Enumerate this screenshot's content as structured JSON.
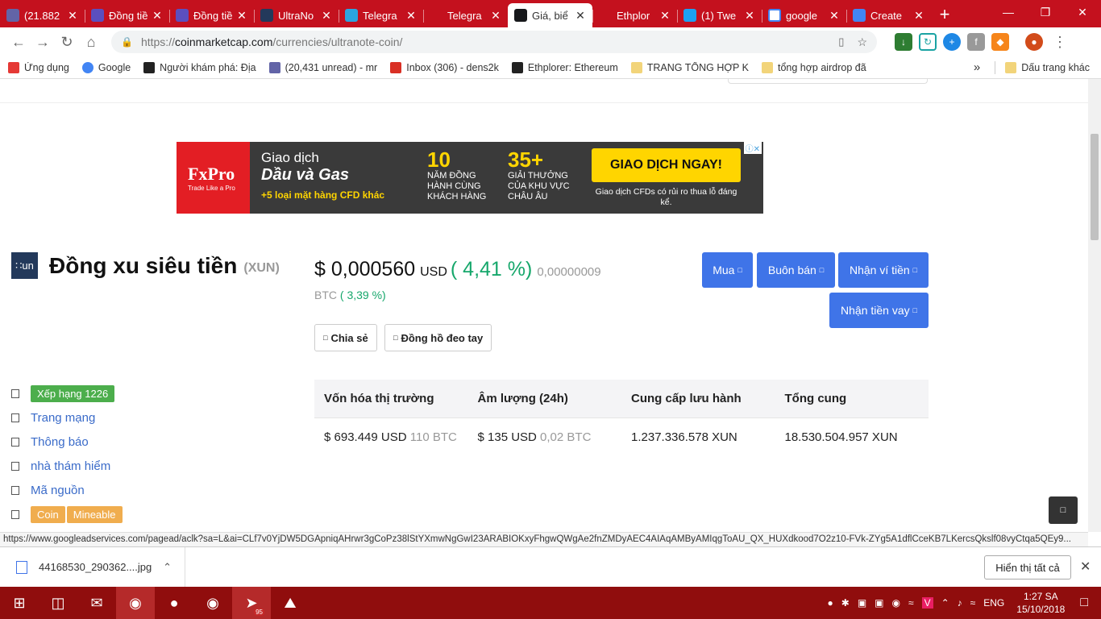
{
  "browser": {
    "tabs": [
      {
        "title": "(21.882",
        "color": "#6264a7",
        "icon": "mail-icon"
      },
      {
        "title": "Đồng tiề",
        "color": "#5b4fbf",
        "icon": "list-icon"
      },
      {
        "title": "Đồng tiề",
        "color": "#5b4fbf",
        "icon": "list-icon"
      },
      {
        "title": "UltraNo",
        "color": "#23395b",
        "icon": "ultranote-icon"
      },
      {
        "title": "Telegra",
        "color": "#2ca5e0",
        "icon": "telegram-icon"
      },
      {
        "title": "Telegra",
        "color": "#c4111e",
        "icon": "doc-icon"
      },
      {
        "title": "Giá, biể",
        "color": "#17181b",
        "icon": "coinmarketcap-icon",
        "active": true
      },
      {
        "title": "Ethplor",
        "color": "#c4111e",
        "icon": "ethplorer-icon"
      },
      {
        "title": "(1) Twe",
        "color": "#1da1f2",
        "icon": "twitter-icon"
      },
      {
        "title": "google",
        "color": "#ffffff",
        "icon": "google-icon"
      },
      {
        "title": "Create",
        "color": "#4285f4",
        "icon": "google-icon"
      }
    ],
    "new_tab_glyph": "+",
    "url_host": "coinmarketcap.com",
    "url_path": "/currencies/ultranote-coin/",
    "url_scheme": "https://",
    "bookmarks": [
      {
        "label": "Ứng dụng",
        "icon": "apps-grid-icon"
      },
      {
        "label": "Google",
        "icon": "google-icon"
      },
      {
        "label": "Người khám phá: Địa",
        "icon": "ethereum-icon"
      },
      {
        "label": "(20,431 unread) - mr",
        "icon": "mail-icon"
      },
      {
        "label": "Inbox (306) - dens2k",
        "icon": "gmail-icon"
      },
      {
        "label": "Ethplorer: Ethereum",
        "icon": "ethereum-icon"
      },
      {
        "label": "TRANG TỔNG HỢP K",
        "icon": "folder-icon"
      },
      {
        "label": "tổng hợp airdrop đã",
        "icon": "folder-icon"
      }
    ],
    "bookmarks_overflow": "»",
    "other_bookmarks": "Dấu trang khác"
  },
  "ad": {
    "brand": "FxPro",
    "brand_tag": "Trade Like a Pro",
    "line1": "Giao dịch",
    "line2": "Dầu và Gas",
    "line3": "+5 loại mặt hàng CFD khác",
    "stat1_num": "10",
    "stat1_text": "NĂM ĐỒNG HÀNH CÙNG KHÁCH HÀNG",
    "stat2_num": "35+",
    "stat2_text": "GIẢI THƯỞNG CỦA KHU VỰC CHÂU ÂU",
    "cta": "GIAO DỊCH NGAY!",
    "disclaimer": "Giao dịch CFDs có rủi ro thua lỗ đáng kể."
  },
  "coin": {
    "logo_text": "∷un",
    "name": "Đồng xu siêu tiền",
    "symbol": "(XUN)",
    "price": "$ 0,000560",
    "currency": "USD",
    "change": "( 4,41 %)",
    "price_btc": "0,00000009",
    "btc_label": "BTC",
    "btc_change": "( 3,39 %)"
  },
  "actions": {
    "buy": "Mua",
    "trade": "Buôn bán",
    "wallet": "Nhận ví tiền",
    "loan": "Nhận tiền vay",
    "share": "Chia sẻ",
    "watch": "Đồng hồ đeo tay"
  },
  "links": {
    "rank": "Xếp hạng 1226",
    "website": "Trang mạng",
    "announcement": "Thông báo",
    "explorer": "nhà thám hiểm",
    "source": "Mã nguồn",
    "tag_coin": "Coin",
    "tag_mineable": "Mineable"
  },
  "stats": {
    "headers": [
      "Vốn hóa thị trường",
      "Âm lượng (24h)",
      "Cung cấp lưu hành",
      "Tổng cung"
    ],
    "market_cap": "$ 693.449 USD",
    "market_cap_btc": "110 BTC",
    "volume": "$ 135 USD",
    "volume_btc": "0,02 BTC",
    "circulating": "1.237.336.578 XUN",
    "total": "18.530.504.957 XUN"
  },
  "status_url": "https://www.googleadservices.com/pagead/aclk?sa=L&ai=CLf7v0YjDW5DGApniqAHrwr3gCoPz38lStYXmwNgGwI23ARABIOKxyFhgwQWgAe2fnZMDyAEC4AIAqAMByAMIqgToAU_QX_HUXdkood7O2z10-FVk-ZYg5A1dflCceKB7LKercsQkslf08vyCtqa5QEy9...",
  "download": {
    "file": "44168530_290362....jpg",
    "show_all": "Hiển thị tất cả"
  },
  "taskbar": {
    "lang": "ENG",
    "time": "1:27 SA",
    "date": "15/10/2018",
    "telegram_badge": "95"
  },
  "colors": {
    "accent": "#3f74e8",
    "positive": "#16a76b",
    "chrome": "#c4111e"
  }
}
